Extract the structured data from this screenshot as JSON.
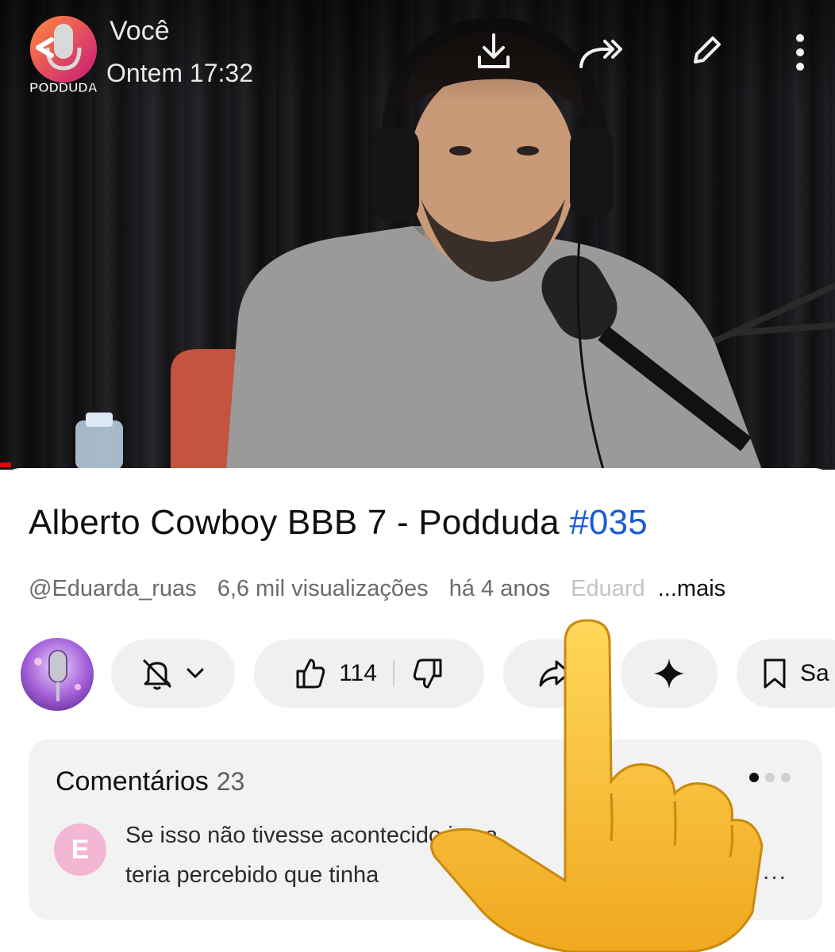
{
  "chat": {
    "sender": "Você",
    "timestamp": "Ontem 17:32",
    "channel_logo_text": "PODDUDA"
  },
  "topbar_icons": [
    "download-icon",
    "forward-icon",
    "edit-icon",
    "more-vertical-icon"
  ],
  "video": {
    "title_main": "Alberto Cowboy BBB 7 - Podduda ",
    "title_hashtag": "#035",
    "hashtag_color": "#1a5bd6",
    "channel_handle": "@Eduarda_ruas",
    "views": "6,6 mil visualizações",
    "age": "há 4 anos",
    "description_snippet": "Eduard",
    "more_label": "...mais"
  },
  "actions": {
    "like_count": "114",
    "save_label": "Sa"
  },
  "comments": {
    "title": "Comentários",
    "count": "23",
    "top_comment": {
      "avatar_letter": "E",
      "avatar_color": "#f3b7d3",
      "text_line1": "Se isso não tivesse acontecido jama",
      "text_line2": "teria percebido que tinha",
      "ellipsis": "..."
    }
  }
}
